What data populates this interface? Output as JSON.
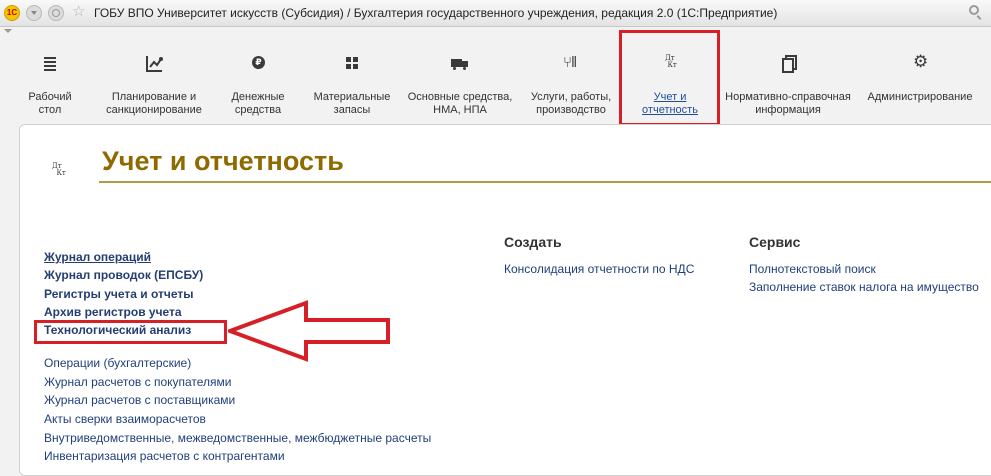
{
  "window": {
    "title": "ГОБУ ВПО Университет искусств (Субсидия) / Бухгалтерия государственного учреждения, редакция 2.0  (1С:Предприятие)",
    "logo_text": "1С"
  },
  "sections": [
    {
      "id": "desktop",
      "label": "Рабочий стол",
      "icon": "list-lines-icon"
    },
    {
      "id": "planning",
      "label": "Планирование и санкционирование",
      "icon": "planning-icon"
    },
    {
      "id": "money",
      "label": "Денежные средства",
      "icon": "ruble-icon"
    },
    {
      "id": "materials",
      "label": "Материальные запасы",
      "icon": "grid-icon"
    },
    {
      "id": "fixed-assets",
      "label": "Основные средства, НМА, НПА",
      "icon": "truck-icon"
    },
    {
      "id": "services",
      "label": "Услуги, работы, производство",
      "icon": "tools-icon"
    },
    {
      "id": "accounting",
      "label": "Учет и отчетность",
      "icon": "dt-kt-icon",
      "active": true
    },
    {
      "id": "reference",
      "label": "Нормативно-справочная информация",
      "icon": "pages-icon"
    },
    {
      "id": "admin",
      "label": "Администрирование",
      "icon": "gear-icon"
    }
  ],
  "icon_text": {
    "dt": "Дт",
    "kt": "Кт"
  },
  "page": {
    "title": "Учет и отчетность"
  },
  "main_links": {
    "bold": [
      "Журнал операций",
      "Журнал проводок (ЕПСБУ)",
      "Регистры учета и отчеты",
      "Архив регистров учета",
      "Технологический анализ"
    ],
    "regular": [
      "Операции (бухгалтерские)",
      "Журнал расчетов с покупателями",
      "Журнал расчетов с поставщиками",
      "Акты сверки взаиморасчетов",
      "Внутриведомственные, межведомственные, межбюджетные расчеты",
      "Инвентаризация расчетов с контрагентами"
    ]
  },
  "create": {
    "heading": "Создать",
    "items": [
      "Консолидация отчетности по НДС"
    ]
  },
  "service": {
    "heading": "Сервис",
    "items": [
      "Полнотекстовый поиск",
      "Заполнение ставок налога на имущество"
    ]
  },
  "colors": {
    "highlight": "#d62027",
    "title": "#8e6a00",
    "link": "#1f3f7a"
  }
}
